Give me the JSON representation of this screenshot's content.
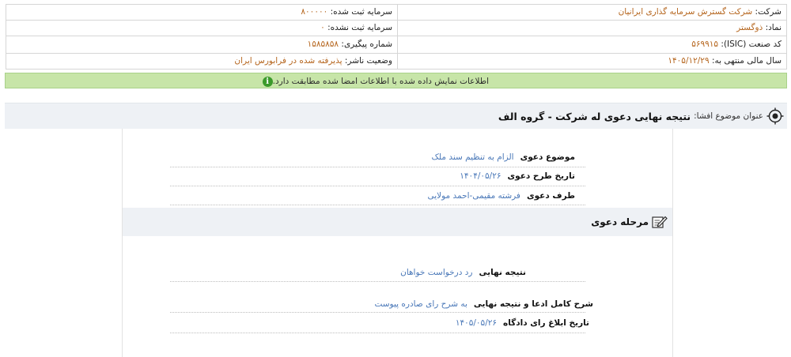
{
  "company_info": {
    "rows": [
      {
        "right": {
          "label": "شرکت:",
          "value": "شرکت گسترش سرمایه گذاری ایرانیان"
        },
        "left": {
          "label": "سرمایه ثبت شده:",
          "value": "۸۰۰۰۰۰"
        }
      },
      {
        "right": {
          "label": "نماد:",
          "value": "ذوگستر"
        },
        "left": {
          "label": "سرمایه ثبت نشده:",
          "value": "۰"
        }
      },
      {
        "right": {
          "label": "کد صنعت (ISIC):",
          "value": "۵۶۹۹۱۵"
        },
        "left": {
          "label": "شماره پیگیری:",
          "value": "۱۵۸۵۸۵۸"
        }
      },
      {
        "right": {
          "label": "سال مالی منتهی به:",
          "value": "۱۴۰۵/۱۲/۲۹"
        },
        "left": {
          "label": "وضعیت ناشر:",
          "value": "پذیرفته شده در فرابورس ایران"
        }
      }
    ]
  },
  "notice": {
    "icon": "info-icon",
    "text": "اطلاعات نمایش داده شده با اطلاعات امضا شده مطابقت دارد."
  },
  "disclosure": {
    "icon": "target-icon",
    "title_label": "عنوان موضوع افشا:",
    "title_value": "نتیجه نهایی دعوی له شرکت - گروه الف"
  },
  "claim": {
    "subject": {
      "label": "موضوع دعوی",
      "value": "الزام به تنظیم سند ملک"
    },
    "filing_date": {
      "label": "تاریخ طرح دعوی",
      "value": "۱۴۰۴/۰۵/۲۶"
    },
    "party": {
      "label": "طرف دعوی",
      "value": "فرشته مقیمی-احمد مولایی"
    }
  },
  "stage": {
    "icon": "edit-icon",
    "title": "مرحله دعوی",
    "final_result": {
      "label": "نتیجه نهایی",
      "value": "رد درخواست خواهان"
    },
    "full_description": {
      "label": "شرح کامل ادعا و نتیجه نهایی",
      "value": "به شرح رای صادره پیوست"
    },
    "verdict_date": {
      "label": "تاریخ ابلاغ رای دادگاه",
      "value": "۱۴۰۵/۰۵/۲۶"
    }
  },
  "colors": {
    "value_orange": "#b5651d",
    "value_blue": "#4a78b8",
    "notice_green": "#c7e5a8",
    "bar_gray": "#eef1f5"
  }
}
